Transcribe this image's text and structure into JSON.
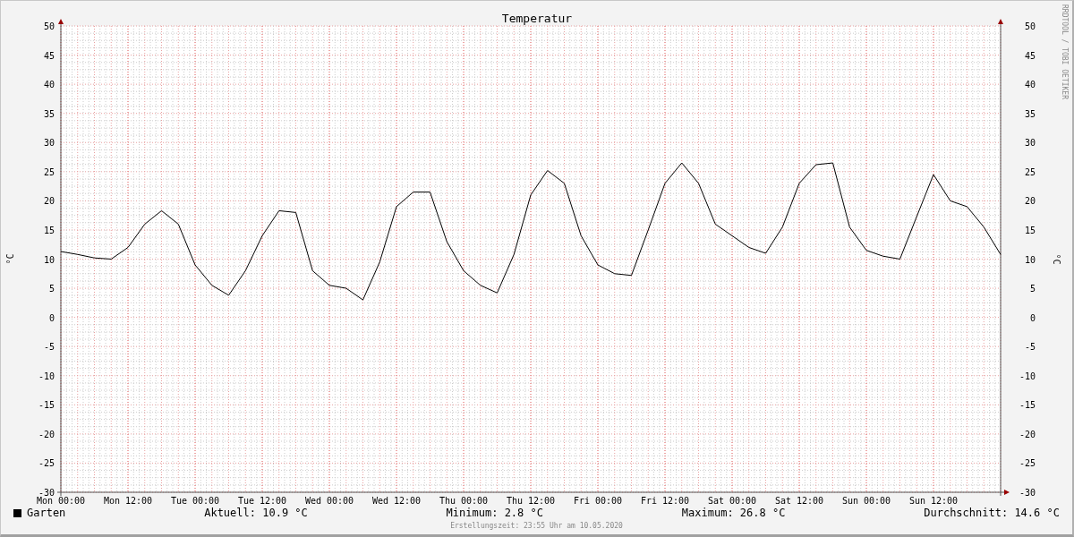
{
  "graph": {
    "title": "Temperatur",
    "credit": "RRDTOOL / TOBI OETIKER",
    "right_ylabel": "°C",
    "right_yticks": [
      "50",
      "45",
      "40",
      "35",
      "30",
      "25",
      "20",
      "15",
      "10",
      "5",
      "0",
      "-5",
      "-10",
      "-15",
      "-20",
      "-25",
      "-30"
    ],
    "chart_data": {
      "type": "line",
      "ylabel": "°C",
      "categories": [
        "Mon 00:00",
        null,
        null,
        null,
        "Mon 12:00",
        null,
        null,
        null,
        "Tue 00:00",
        null,
        null,
        null,
        "Tue 12:00",
        null,
        null,
        null,
        "Wed 00:00",
        null,
        null,
        null,
        "Wed 12:00",
        null,
        null,
        null,
        "Thu 00:00",
        null,
        null,
        null,
        "Thu 12:00",
        null,
        null,
        null,
        "Fri 00:00",
        null,
        null,
        null,
        "Fri 12:00",
        null,
        null,
        null,
        "Sat 00:00",
        null,
        null,
        null,
        "Sat 12:00",
        null,
        null,
        null,
        "Sun 00:00",
        null,
        null,
        null,
        "Sun 12:00",
        null,
        null,
        null,
        null
      ],
      "series": [
        {
          "name": "Garten",
          "color": "#000000",
          "values": [
            11.3,
            10.8,
            10.2,
            10.0,
            12.0,
            16.0,
            18.3,
            16.0,
            9.0,
            5.5,
            3.8,
            8.0,
            14.0,
            18.3,
            18.0,
            8.0,
            5.5,
            5.0,
            3.0,
            9.5,
            19.0,
            21.5,
            21.5,
            13.0,
            8.0,
            5.5,
            4.2,
            10.8,
            21.0,
            25.2,
            23.0,
            14.0,
            9.0,
            7.5,
            7.2,
            15.0,
            23.0,
            26.5,
            23.0,
            16.0,
            14.0,
            12.0,
            11.0,
            15.5,
            23.0,
            26.2,
            26.5,
            15.5,
            11.5,
            10.5,
            10.0,
            17.3,
            24.5,
            20.0,
            19.0,
            15.5,
            10.8
          ]
        }
      ],
      "ylim": [
        -30,
        50
      ],
      "grid": true,
      "yticks": [
        50,
        45,
        40,
        35,
        30,
        25,
        20,
        15,
        10,
        5,
        0,
        -5,
        -10,
        -15,
        -20,
        -25,
        -30
      ]
    }
  },
  "legend": {
    "stats": [
      "Aktuell: 10.9 °C",
      "Minimum: 2.8 °C",
      "Maximum: 26.8 °C",
      "Durchschnitt: 14.6 °C"
    ]
  },
  "footer": "Erstellungszeit: 23:55 Uhr am 10.05.2020"
}
